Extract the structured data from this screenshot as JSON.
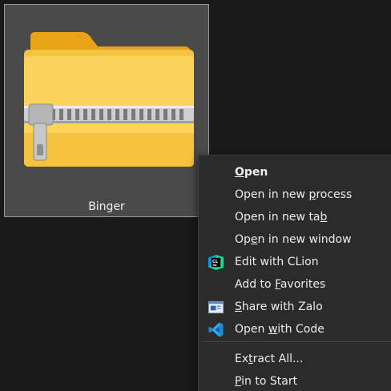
{
  "file": {
    "name": "Binger",
    "icon": "zip-folder-icon"
  },
  "menu": {
    "items": [
      {
        "pre": "",
        "key": "O",
        "post": "pen",
        "bold": true,
        "icon": ""
      },
      {
        "pre": "Open in new ",
        "key": "p",
        "post": "rocess",
        "bold": false,
        "icon": ""
      },
      {
        "pre": "Open in new ta",
        "key": "b",
        "post": "",
        "bold": false,
        "icon": ""
      },
      {
        "pre": "Op",
        "key": "e",
        "post": "n in new window",
        "bold": false,
        "icon": ""
      },
      {
        "pre": "Edit with CLion",
        "key": "",
        "post": "",
        "bold": false,
        "icon": "clion-icon"
      },
      {
        "pre": "Add to ",
        "key": "F",
        "post": "avorites",
        "bold": false,
        "icon": ""
      },
      {
        "pre": "",
        "key": "S",
        "post": "hare with Zalo",
        "bold": false,
        "icon": "zalo-share-icon"
      },
      {
        "pre": "Open ",
        "key": "w",
        "post": "ith Code",
        "bold": false,
        "icon": "vscode-icon"
      },
      {
        "pre": "Ex",
        "key": "t",
        "post": "ract All...",
        "bold": false,
        "icon": ""
      },
      {
        "pre": "",
        "key": "P",
        "post": "in to Start",
        "bold": false,
        "icon": ""
      }
    ]
  },
  "colors": {
    "desktop_bg": "#191919",
    "tile_bg": "#4a4a4a",
    "menu_bg": "#2b2b2b",
    "menu_text": "#ececec"
  }
}
